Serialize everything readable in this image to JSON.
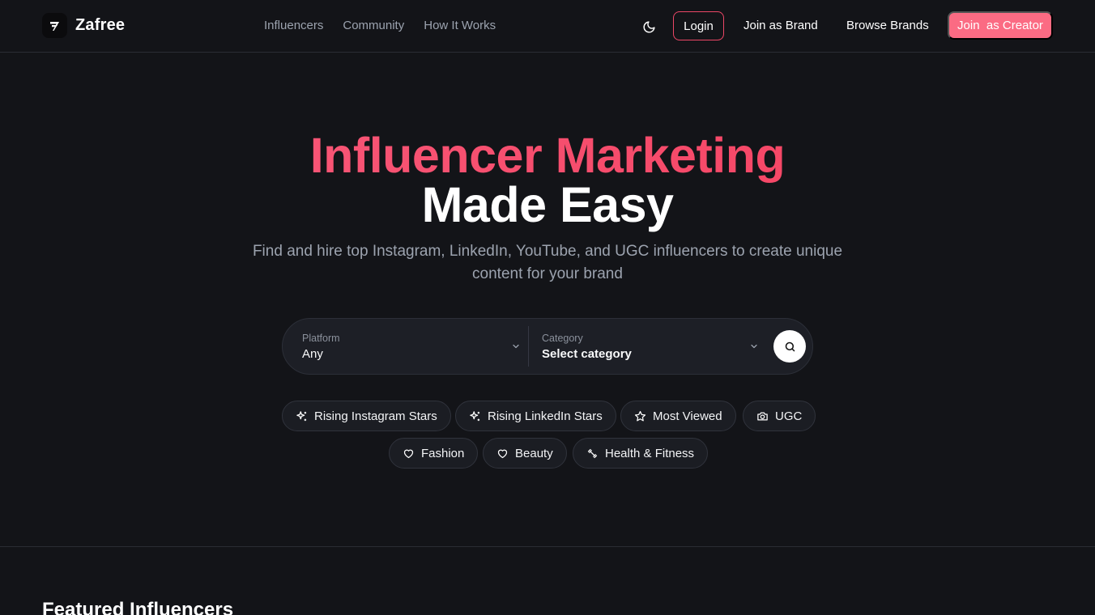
{
  "header": {
    "brand": "Zafree",
    "nav": [
      "Influencers",
      "Community",
      "How It Works"
    ],
    "login_label": "Login",
    "join_brand_label": "Join as Brand",
    "browse_brands_label": "Browse Brands",
    "join_creator_label": "Join  as Creator"
  },
  "hero": {
    "title_line1": "Influencer Marketing",
    "title_line2": "Made Easy",
    "subtitle": "Find and hire top Instagram, LinkedIn, YouTube, and UGC influencers to create unique content for your brand"
  },
  "search": {
    "platform_label": "Platform",
    "platform_value": "Any",
    "category_label": "Category",
    "category_value": "Select category"
  },
  "chips": [
    {
      "label": "Rising Instagram Stars",
      "icon": "sparkles-icon"
    },
    {
      "label": "Rising LinkedIn Stars",
      "icon": "sparkles-icon"
    },
    {
      "label": "Most Viewed",
      "icon": "star-icon"
    },
    {
      "label": "UGC",
      "icon": "camera-icon"
    },
    {
      "label": "Fashion",
      "icon": "heart-icon"
    },
    {
      "label": "Beauty",
      "icon": "heart-icon"
    },
    {
      "label": "Health & Fitness",
      "icon": "dumbbell-icon"
    }
  ],
  "featured": {
    "title": "Featured Influencers"
  },
  "colors": {
    "background": "#131418",
    "accent": "#f43f5e",
    "accent_button": "#fb6b83"
  }
}
